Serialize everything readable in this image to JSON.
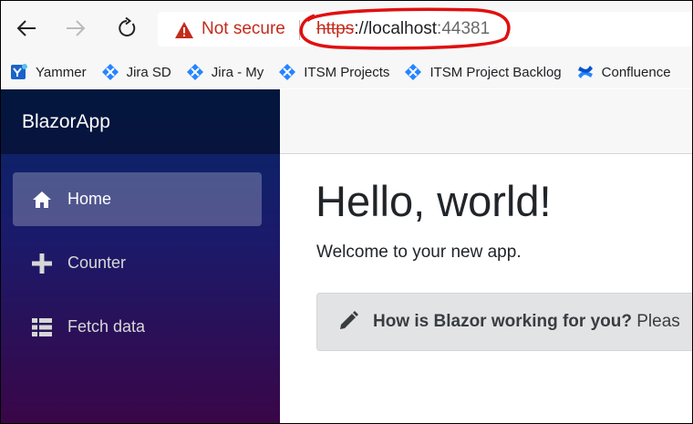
{
  "browser": {
    "security_label": "Not secure",
    "url_scheme": "https",
    "url_sep": "://",
    "url_host": "localhost",
    "url_port": ":44381",
    "bookmarks": [
      {
        "label": "Yammer",
        "icon": "yammer-icon"
      },
      {
        "label": "Jira SD",
        "icon": "jira-icon"
      },
      {
        "label": "Jira - My",
        "icon": "jira-icon"
      },
      {
        "label": "ITSM Projects",
        "icon": "jira-icon"
      },
      {
        "label": "ITSM Project Backlog",
        "icon": "jira-icon"
      },
      {
        "label": "Confluence",
        "icon": "confluence-icon"
      }
    ]
  },
  "app": {
    "brand": "BlazorApp",
    "nav": [
      {
        "label": "Home",
        "icon": "home-icon",
        "active": true
      },
      {
        "label": "Counter",
        "icon": "plus-icon",
        "active": false
      },
      {
        "label": "Fetch data",
        "icon": "list-icon",
        "active": false
      }
    ],
    "heading": "Hello, world!",
    "welcome": "Welcome to your new app.",
    "survey": {
      "question": "How is Blazor working for you?",
      "trailing": "Pleas"
    }
  },
  "colors": {
    "not_secure": "#c42b1c",
    "sidebar_top": "#052767",
    "sidebar_bottom": "#3a0647",
    "annotation_circle": "#e01010"
  }
}
